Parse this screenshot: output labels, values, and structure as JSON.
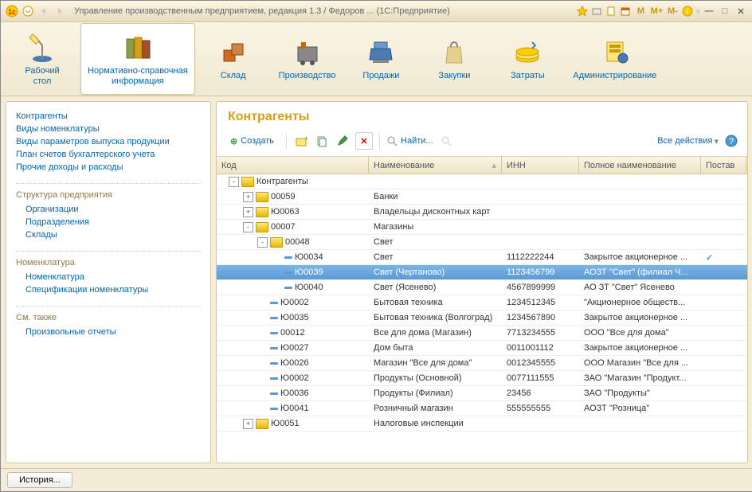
{
  "titlebar": {
    "text": "Управление производственным предприятием, редакция 1.3 / Федоров ...   (1С:Предприятие)",
    "m": "M",
    "mp": "M+",
    "mm": "M-"
  },
  "toolbar": [
    {
      "id": "desktop",
      "label": "Рабочий\nстол"
    },
    {
      "id": "nsi",
      "label": "Нормативно-справочная\nинформация"
    },
    {
      "id": "warehouse",
      "label": "Склад"
    },
    {
      "id": "production",
      "label": "Производство"
    },
    {
      "id": "sales",
      "label": "Продажи"
    },
    {
      "id": "purchases",
      "label": "Закупки"
    },
    {
      "id": "costs",
      "label": "Затраты"
    },
    {
      "id": "admin",
      "label": "Администрирование"
    }
  ],
  "sidebar": {
    "group1": [
      "Контрагенты",
      "Виды номенклатуры",
      "Виды параметров выпуска продукции",
      "План счетов бухгалтерского учета",
      "Прочие доходы и расходы"
    ],
    "h2": "Структура предприятия",
    "group2": [
      "Организации",
      "Подразделения",
      "Склады"
    ],
    "h3": "Номенклатура",
    "group3": [
      "Номенклатура",
      "Спецификации номенклатуры"
    ],
    "h4": "См. также",
    "group4": [
      "Произвольные отчеты"
    ]
  },
  "main": {
    "title": "Контрагенты",
    "create": "Создать",
    "find": "Найти...",
    "all_actions": "Все действия",
    "headers": {
      "code": "Код",
      "name": "Наименование",
      "inn": "ИНН",
      "full": "Полное наименование",
      "sup": "Постав"
    }
  },
  "rows": [
    {
      "lvl": 0,
      "tog": "-",
      "folder": true,
      "code": "",
      "name": "Контрагенты"
    },
    {
      "lvl": 1,
      "tog": "+",
      "folder": true,
      "code": "00059",
      "name": "Банки"
    },
    {
      "lvl": 1,
      "tog": "+",
      "folder": true,
      "code": "Ю0063",
      "name": "Владельцы дисконтных карт"
    },
    {
      "lvl": 1,
      "tog": "-",
      "folder": true,
      "code": "00007",
      "name": "Магазины"
    },
    {
      "lvl": 2,
      "tog": "-",
      "folder": true,
      "code": "00048",
      "name": "Свет"
    },
    {
      "lvl": 3,
      "tog": "",
      "folder": false,
      "code": "Ю0034",
      "name": "Свет",
      "inn": "1112222244",
      "full": "Закрытое акционерное ...",
      "sup": "✓"
    },
    {
      "lvl": 3,
      "tog": "",
      "folder": false,
      "code": "Ю0039",
      "name": "Свет (Чертаново)",
      "inn": "1123456799",
      "full": "АОЗТ \"Свет\" (филиал Ч...",
      "sel": true
    },
    {
      "lvl": 3,
      "tog": "",
      "folder": false,
      "code": "Ю0040",
      "name": "Свет (Ясенево)",
      "inn": "4567899999",
      "full": "АО ЗТ \"Свет\" Ясенево"
    },
    {
      "lvl": 2,
      "tog": "",
      "folder": false,
      "code": "Ю0002",
      "name": "Бытовая техника",
      "inn": "1234512345",
      "full": "\"Акционерное обществ..."
    },
    {
      "lvl": 2,
      "tog": "",
      "folder": false,
      "code": "Ю0035",
      "name": "Бытовая техника (Волгоград)",
      "inn": "1234567890",
      "full": "Закрытое акционерное ..."
    },
    {
      "lvl": 2,
      "tog": "",
      "folder": false,
      "code": "00012",
      "name": "Все для дома (Магазин)",
      "inn": "7713234555",
      "full": "ООО \"Все для дома\""
    },
    {
      "lvl": 2,
      "tog": "",
      "folder": false,
      "code": "Ю0027",
      "name": "Дом быта",
      "inn": "0011001112",
      "full": "Закрытое акционерное ..."
    },
    {
      "lvl": 2,
      "tog": "",
      "folder": false,
      "code": "Ю0026",
      "name": "Магазин \"Все для дома\"",
      "inn": "0012345555",
      "full": "ООО Магазин \"Все для ..."
    },
    {
      "lvl": 2,
      "tog": "",
      "folder": false,
      "code": "Ю0002",
      "name": "Продукты (Основной)",
      "inn": "0077111555",
      "full": "ЗАО \"Магазин \"Продукт..."
    },
    {
      "lvl": 2,
      "tog": "",
      "folder": false,
      "code": "Ю0036",
      "name": "Продукты (Филиал)",
      "inn": "23456",
      "full": "ЗАО \"Продукты\""
    },
    {
      "lvl": 2,
      "tog": "",
      "folder": false,
      "code": "Ю0041",
      "name": "Розничный магазин",
      "inn": "555555555",
      "full": "АОЗТ \"Розница\""
    },
    {
      "lvl": 1,
      "tog": "+",
      "folder": true,
      "code": "Ю0051",
      "name": "Налоговые инспекции"
    }
  ],
  "status": {
    "history": "История..."
  }
}
